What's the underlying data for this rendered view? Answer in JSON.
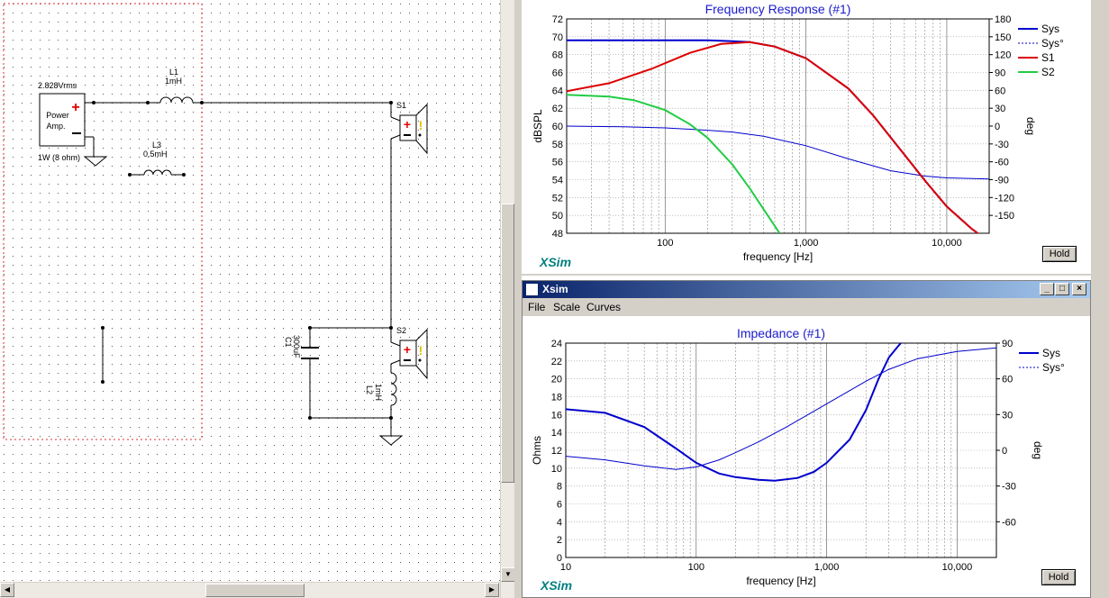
{
  "schematic": {
    "source_voltage": "2.828Vrms",
    "source_name": "Power Amp.",
    "source_note": "1W (8 ohm)",
    "L1_name": "L1",
    "L1_value": "1mH",
    "L3_name": "L3",
    "L3_value": "0.5mH",
    "S1_name": "S1",
    "S2_name": "S2",
    "C1_name": "C1",
    "C1_value": "300uF",
    "L2_name": "L2",
    "L2_value": "1mH"
  },
  "fr_window": {
    "hold_label": "Hold",
    "logo": "XSim"
  },
  "imp_window": {
    "title": "Xsim",
    "menu": [
      "File",
      "Scale",
      "Curves"
    ],
    "hold_label": "Hold",
    "logo": "XSim"
  },
  "chart_data": [
    {
      "type": "line",
      "title": "Frequency Response (#1)",
      "xlabel": "frequency [Hz]",
      "ylabel": "dBSPL",
      "y2label": "deg",
      "x_scale": "log",
      "xlim": [
        20,
        20000
      ],
      "ylim": [
        48,
        72
      ],
      "y2lim": [
        -180,
        180
      ],
      "x_tick_labels": [
        "100",
        "1,000",
        "10,000"
      ],
      "y_ticks": [
        48,
        50,
        52,
        54,
        56,
        58,
        60,
        62,
        64,
        66,
        68,
        70,
        72
      ],
      "y2_ticks": [
        -150,
        -120,
        -90,
        -60,
        -30,
        0,
        30,
        60,
        90,
        120,
        150,
        180
      ],
      "grid": true,
      "legend_position": "right",
      "series": [
        {
          "name": "Sys",
          "color": "#0000cc",
          "axis": "left",
          "x": [
            20,
            100,
            200,
            300,
            400,
            600,
            1000,
            2000,
            3000,
            5000,
            7000,
            10000,
            15000,
            18000
          ],
          "y": [
            69.6,
            69.6,
            69.6,
            69.5,
            69.4,
            68.9,
            67.6,
            64.2,
            61.2,
            56.8,
            53.9,
            51.0,
            48.5,
            47.6
          ]
        },
        {
          "name": "Sys°",
          "color": "#0000cc",
          "axis": "right",
          "x": [
            20,
            50,
            100,
            200,
            300,
            500,
            1000,
            2000,
            4000,
            7000,
            10000,
            20000
          ],
          "y": [
            0,
            -1,
            -3,
            -7,
            -10,
            -17,
            -33,
            -55,
            -75,
            -84,
            -87,
            -89
          ]
        },
        {
          "name": "S1",
          "color": "#dd0000",
          "axis": "left",
          "x": [
            20,
            40,
            80,
            150,
            250,
            400,
            600,
            1000,
            2000,
            3000,
            5000,
            7000,
            10000,
            15000,
            18000
          ],
          "y": [
            63.9,
            64.8,
            66.4,
            68.2,
            69.2,
            69.4,
            68.9,
            67.6,
            64.2,
            61.2,
            56.8,
            53.9,
            51.0,
            48.5,
            47.6
          ]
        },
        {
          "name": "S2",
          "color": "#22cc44",
          "axis": "left",
          "x": [
            20,
            40,
            60,
            100,
            150,
            200,
            300,
            400,
            500,
            650
          ],
          "y": [
            63.5,
            63.3,
            62.9,
            61.8,
            60.2,
            58.7,
            55.7,
            53.0,
            50.7,
            48.0
          ]
        }
      ]
    },
    {
      "type": "line",
      "title": "Impedance (#1)",
      "xlabel": "frequency [Hz]",
      "ylabel": "Ohms",
      "y2label": "deg",
      "x_scale": "log",
      "xlim": [
        10,
        20000
      ],
      "ylim": [
        0,
        24
      ],
      "y2lim": [
        -90,
        90
      ],
      "x_tick_labels": [
        "10",
        "100",
        "1,000",
        "10,000"
      ],
      "y_ticks": [
        0,
        2,
        4,
        6,
        8,
        10,
        12,
        14,
        16,
        18,
        20,
        22,
        24
      ],
      "y2_ticks": [
        -60,
        -30,
        0,
        30,
        60,
        90
      ],
      "grid": true,
      "legend_position": "right",
      "series": [
        {
          "name": "Sys",
          "color": "#0000cc",
          "axis": "left",
          "x": [
            10,
            20,
            40,
            70,
            100,
            150,
            200,
            300,
            400,
            600,
            800,
            1000,
            1500,
            2000,
            2500,
            3000,
            3500,
            3700
          ],
          "y": [
            16.6,
            16.2,
            14.6,
            12.2,
            10.6,
            9.4,
            9.0,
            8.7,
            8.6,
            8.9,
            9.6,
            10.6,
            13.2,
            16.5,
            20.0,
            22.4,
            23.6,
            24
          ]
        },
        {
          "name": "Sys°",
          "color": "#0000cc",
          "axis": "right",
          "x": [
            10,
            20,
            40,
            70,
            100,
            150,
            200,
            300,
            500,
            1000,
            2000,
            3000,
            5000,
            10000,
            20000
          ],
          "y": [
            -5,
            -8,
            -13,
            -16,
            -14,
            -8,
            -2,
            7,
            20,
            39,
            58,
            68,
            77,
            83,
            86
          ]
        }
      ]
    }
  ]
}
